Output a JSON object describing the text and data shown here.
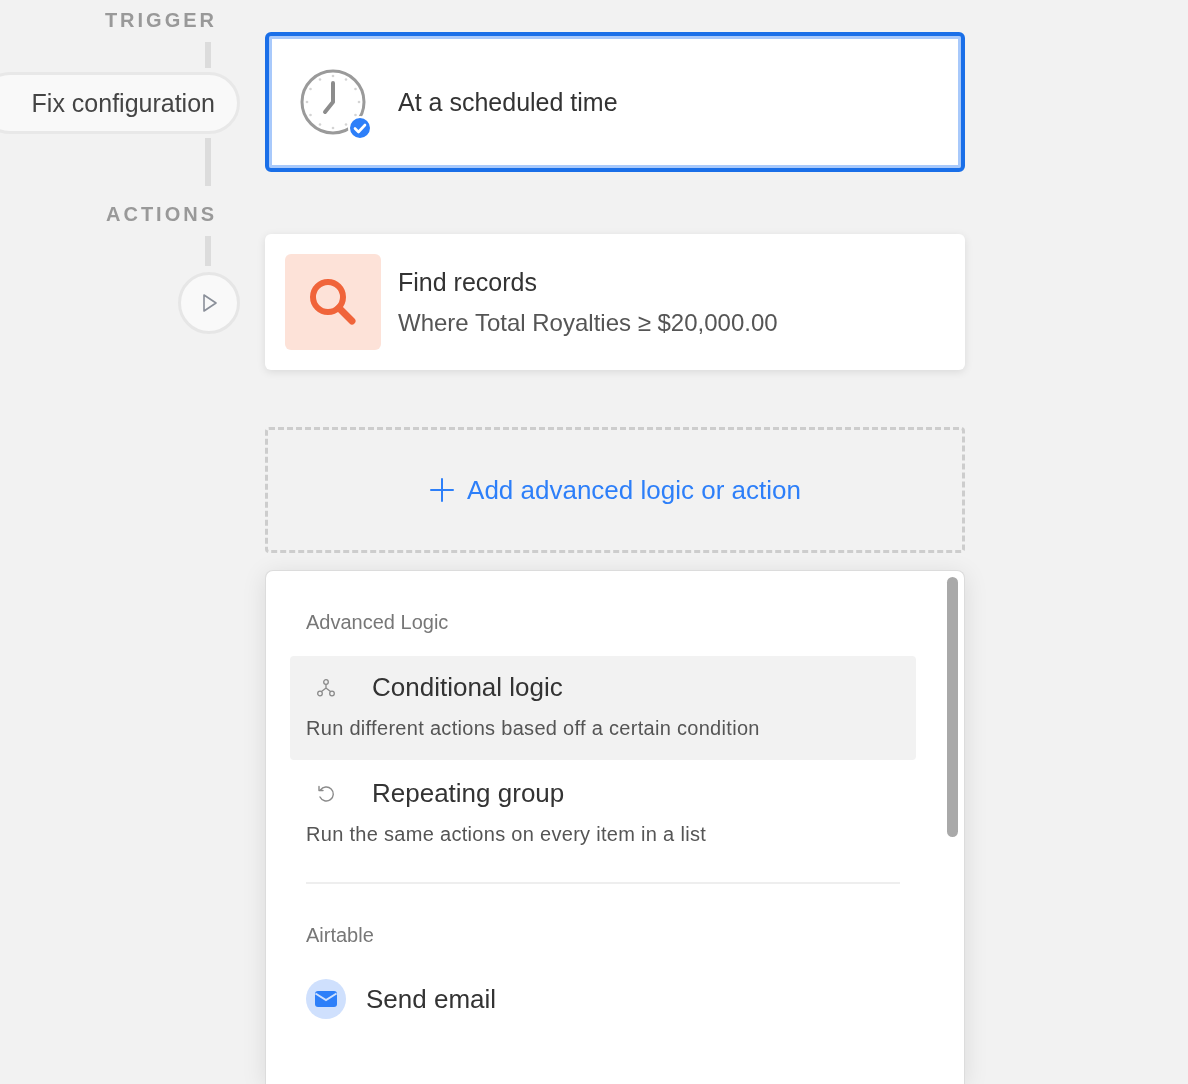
{
  "rail": {
    "trigger_label": "TRIGGER",
    "fix_button": "Fix configuration",
    "actions_label": "ACTIONS"
  },
  "trigger": {
    "title": "At a scheduled time",
    "selected": true
  },
  "actions": [
    {
      "title": "Find records",
      "subtitle": "Where Total Royalties ≥ $20,000.00"
    }
  ],
  "add_button": {
    "label": "Add advanced logic or action"
  },
  "menu": {
    "sections": [
      {
        "title": "Advanced Logic",
        "items": [
          {
            "kind": "branch",
            "title": "Conditional logic",
            "description": "Run different actions based off a certain condition",
            "selected": true
          },
          {
            "kind": "repeat",
            "title": "Repeating group",
            "description": "Run the same actions on every item in a list",
            "selected": false
          }
        ]
      },
      {
        "title": "Airtable",
        "items": [
          {
            "kind": "email",
            "title": "Send email",
            "selected": false
          }
        ]
      }
    ]
  }
}
